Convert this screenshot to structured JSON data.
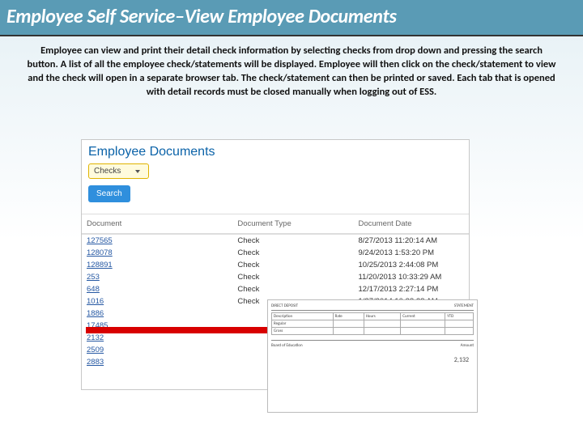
{
  "title": "Employee Self Service–View Employee Documents",
  "intro": "Employee can view and print their detail check information by selecting checks from drop down and pressing the search button.  A list of all the employee check/statements will be displayed.  Employee will then click on the check/statement to view and the check will open in a separate browser tab.  The check/statement can then be printed or saved.  Each tab that is opened with detail records must be closed manually when logging out of ESS.",
  "app": {
    "pageTitle": "Employee Documents",
    "dropdownLabel": "Checks",
    "searchLabel": "Search"
  },
  "columns": {
    "doc": "Document",
    "type": "Document Type",
    "date": "Document Date"
  },
  "rows": [
    {
      "doc": "127565",
      "type": "Check",
      "date": "8/27/2013 11:20:14 AM"
    },
    {
      "doc": "128078",
      "type": "Check",
      "date": "9/24/2013 1:53:20 PM"
    },
    {
      "doc": "128891",
      "type": "Check",
      "date": "10/25/2013 2:44:08 PM"
    },
    {
      "doc": "253",
      "type": "Check",
      "date": "11/20/2013 10:33:29 AM"
    },
    {
      "doc": "648",
      "type": "Check",
      "date": "12/17/2013 2:27:14 PM"
    },
    {
      "doc": "1016",
      "type": "Check",
      "date": "1/27/2014 10:38:28 AM"
    },
    {
      "doc": "1886",
      "type": "",
      "date": ""
    },
    {
      "doc": "17485",
      "type": "",
      "date": ""
    },
    {
      "doc": "2132",
      "type": "",
      "date": ""
    },
    {
      "doc": "2509",
      "type": "",
      "date": ""
    },
    {
      "doc": "2883",
      "type": "",
      "date": ""
    }
  ],
  "check": {
    "issuer": "Board of Education",
    "amountLabel": "Amount",
    "amount": "2,132"
  }
}
